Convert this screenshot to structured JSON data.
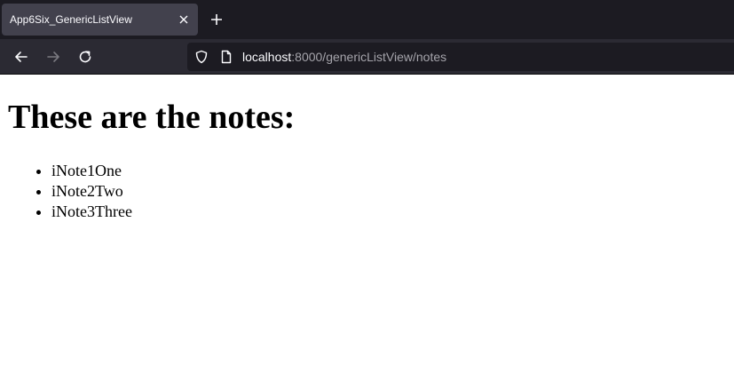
{
  "browser": {
    "tab_title": "App6Six_GenericListView",
    "url_host": "localhost",
    "url_rest": ":8000/genericListView/notes"
  },
  "page": {
    "heading": "These are the notes:",
    "notes": [
      "iNote1One",
      "iNote2Two",
      "iNote3Three"
    ]
  },
  "colors": {
    "chrome_bg": "#1c1b22",
    "toolbar_bg": "#2b2a33",
    "active_tab_bg": "#42414d",
    "chrome_text": "#fbfbfe",
    "url_dim_text": "#a5a4ab"
  },
  "icons": [
    "close-icon",
    "plus-icon",
    "back-arrow-icon",
    "forward-arrow-icon",
    "reload-icon",
    "shield-icon",
    "page-icon"
  ]
}
